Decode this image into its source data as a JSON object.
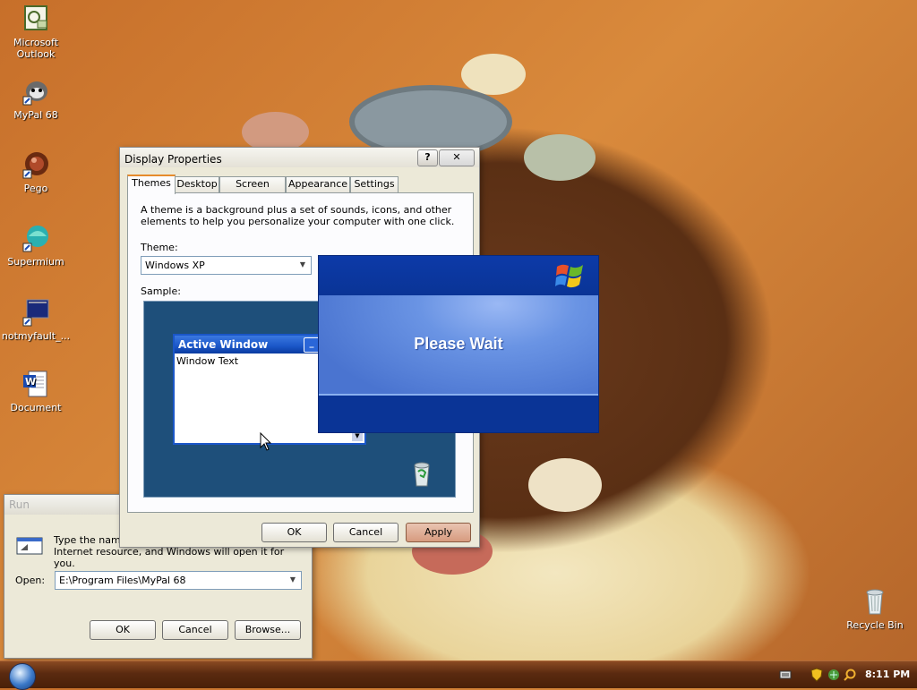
{
  "desktop": {
    "icons": [
      {
        "label": "Microsoft Outlook",
        "icon": "outlook-icon"
      },
      {
        "label": "MyPal 68",
        "icon": "mypal-icon"
      },
      {
        "label": "Pego",
        "icon": "pego-icon"
      },
      {
        "label": "Supermium",
        "icon": "supermium-icon"
      },
      {
        "label": "notmyfault_...",
        "icon": "notmyfault-icon"
      },
      {
        "label": "Document",
        "icon": "word-document-icon"
      },
      {
        "label": "Recycle Bin",
        "icon": "recycle-bin-icon"
      }
    ]
  },
  "display_properties": {
    "title": "Display Properties",
    "help_btn": "?",
    "close_btn": "✕",
    "tabs": [
      "Themes",
      "Desktop",
      "Screen Saver",
      "Appearance",
      "Settings"
    ],
    "active_tab": "Themes",
    "description": "A theme is a background plus a set of sounds, icons, and other elements to help you personalize your computer with one click.",
    "theme_label": "Theme:",
    "theme_value": "Windows XP",
    "sample_label": "Sample:",
    "sample_window_title": "Active Window",
    "sample_window_text": "Window Text",
    "buttons": {
      "ok": "OK",
      "cancel": "Cancel",
      "apply": "Apply"
    }
  },
  "please_wait": {
    "message": "Please Wait",
    "logo": "windows-flag-icon"
  },
  "run_dialog": {
    "title": "Run",
    "description": "Type the name of a program, folder, document, or Internet resource, and Windows will open it for you.",
    "open_label": "Open:",
    "open_value": "E:\\Program Files\\MyPal 68",
    "buttons": {
      "ok": "OK",
      "cancel": "Cancel",
      "browse": "Browse..."
    }
  },
  "taskbar": {
    "clock": "8:11 PM",
    "tray_icons": [
      "keyboard-icon",
      "security-shield-icon",
      "network-icon",
      "search-icon"
    ]
  },
  "colors": {
    "xp_blue": "#0a3a9c",
    "xp_blue_light": "#5a8ce0",
    "sample_bg": "#1e4f7a",
    "active_title": "#1a56c8"
  }
}
